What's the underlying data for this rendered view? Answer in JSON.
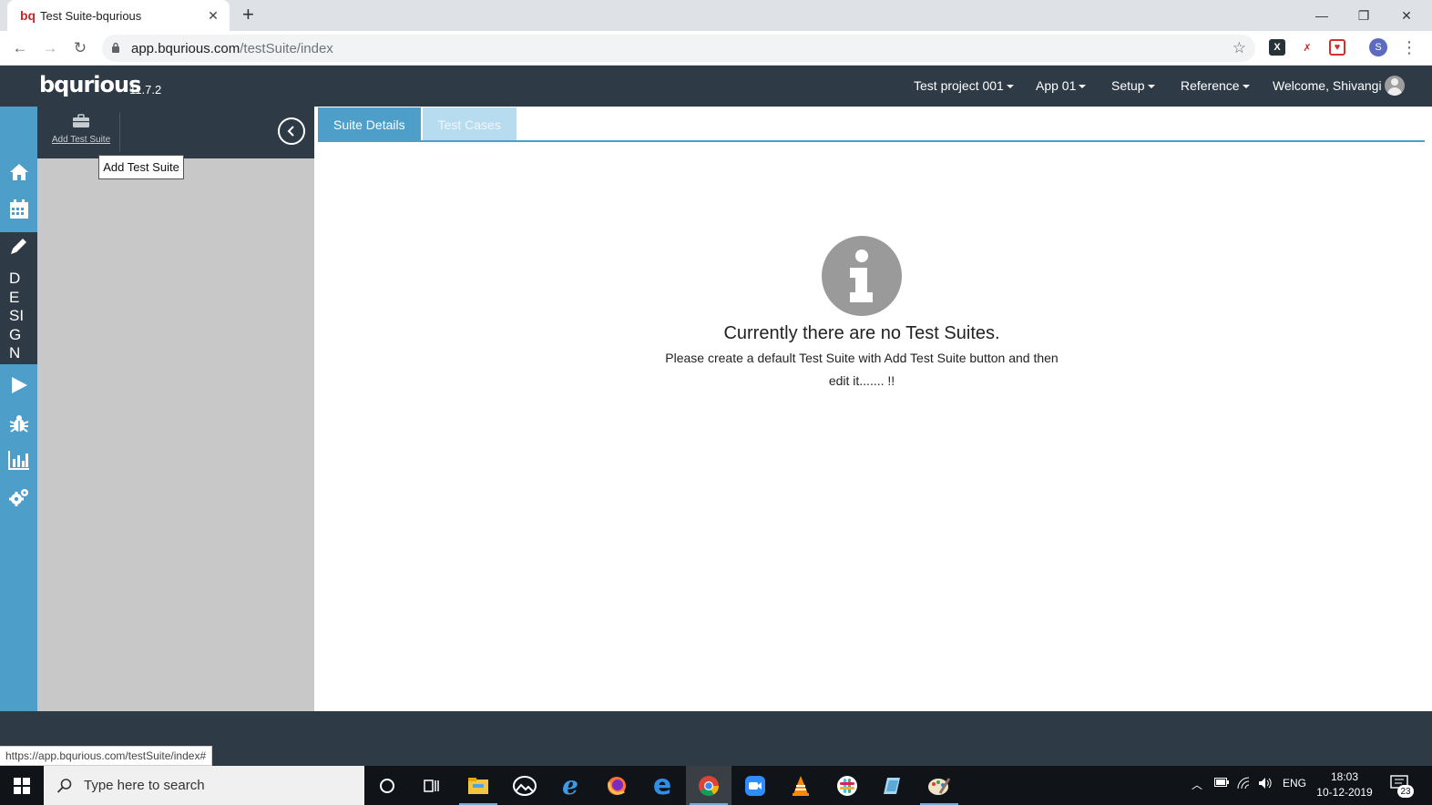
{
  "browser": {
    "tab_title": "Test Suite-bqurious",
    "tab_favicon_text": "bq",
    "url_host": "app.bqurious.com",
    "url_path": "/testSuite/index",
    "profile_initial": "S",
    "status_url": "https://app.bqurious.com/testSuite/index#",
    "ext_x_label": "X"
  },
  "app": {
    "logo": "bqurious",
    "version": "11.7.2",
    "menu": {
      "project": "Test project 001",
      "app": "App 01",
      "setup": "Setup",
      "reference": "Reference",
      "welcome": "Welcome, Shivangi"
    }
  },
  "rail": {
    "design_letters": [
      "D",
      "E",
      "SI",
      "G",
      "N"
    ]
  },
  "sidebar": {
    "add_label": "Add Test Suite",
    "tooltip": "Add Test Suite"
  },
  "main": {
    "tabs": [
      {
        "label": "Suite Details",
        "active": true
      },
      {
        "label": "Test Cases",
        "active": false
      }
    ],
    "empty_title": "Currently there are no Test Suites.",
    "empty_line1": "Please create a default Test Suite with Add Test Suite button and then",
    "empty_line2": "edit it....... !!"
  },
  "taskbar": {
    "search_placeholder": "Type here to search",
    "language": "ENG",
    "time": "18:03",
    "date": "10-12-2019",
    "notifications": "23"
  },
  "colors": {
    "header_bg": "#2e3a46",
    "rail_bg": "#4d9ec9",
    "sidebar_bg": "#c8c8c8",
    "tab_active": "#4d9ec9",
    "tab_inactive": "#b8dcef"
  }
}
